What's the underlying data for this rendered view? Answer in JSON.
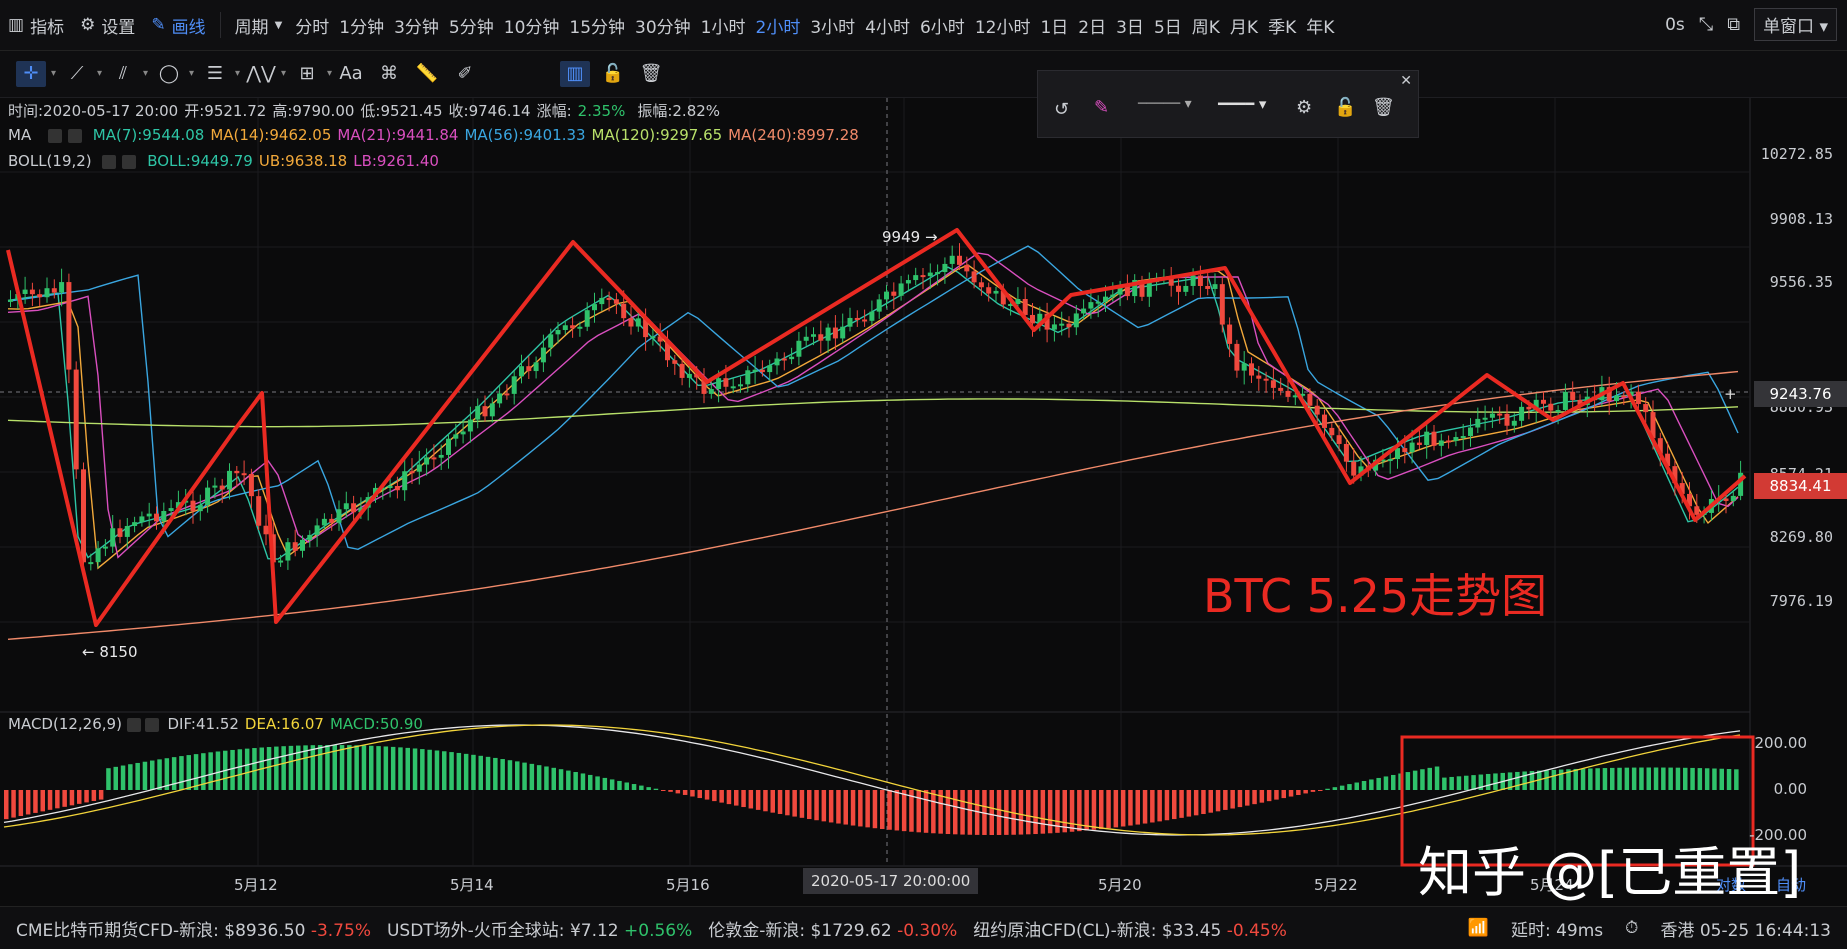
{
  "topbar": {
    "indicator": "指标",
    "settings": "设置",
    "draw": "画线",
    "period_label": "周期",
    "periods": [
      "分时",
      "1分钟",
      "3分钟",
      "5分钟",
      "10分钟",
      "15分钟",
      "30分钟",
      "1小时",
      "2小时",
      "3小时",
      "4小时",
      "6小时",
      "12小时",
      "1日",
      "2日",
      "3日",
      "5日",
      "周K",
      "月K",
      "季K",
      "年K"
    ],
    "active_period": "2小时",
    "right": {
      "counter": "0s",
      "window_mode": "单窗口"
    }
  },
  "info": {
    "line1": {
      "time": "时间:2020-05-17 20:00",
      "open": "开:9521.72",
      "high": "高:9790.00",
      "low": "低:9521.45",
      "close": "收:9746.14",
      "change_label": "涨幅:",
      "change": "2.35%",
      "amplitude": "振幅:2.82%"
    },
    "ma_label": "MA",
    "ma": [
      {
        "text": "MA(7):9544.08",
        "color": "#2ec5a6"
      },
      {
        "text": "MA(14):9462.05",
        "color": "#f2a93b"
      },
      {
        "text": "MA(21):9441.84",
        "color": "#d94fbf"
      },
      {
        "text": "MA(56):9401.33",
        "color": "#3aa6e0"
      },
      {
        "text": "MA(120):9297.65",
        "color": "#b8e06a"
      },
      {
        "text": "MA(240):8997.28",
        "color": "#f08a6a"
      }
    ],
    "boll_label": "BOLL(19,2)",
    "boll": [
      {
        "text": "BOLL:9449.79",
        "color": "#2ec5a6"
      },
      {
        "text": "UB:9638.18",
        "color": "#f2a93b"
      },
      {
        "text": "LB:9261.40",
        "color": "#d94fbf"
      }
    ]
  },
  "price_axis": [
    "10272.85",
    "9908.13",
    "9556.35",
    "9243.76",
    "8880.93",
    "8574.21",
    "8269.80",
    "7976.19"
  ],
  "crosshair_price": "9243.76",
  "last_price": "8834.41",
  "annotations": {
    "high_label": "9949 →",
    "low_label": "← 8150",
    "title": "BTC 5.25走势图"
  },
  "macd": {
    "label": "MACD(12,26,9)",
    "dif": "DIF:41.52",
    "dea": "DEA:16.07",
    "macd": "MACD:50.90",
    "ticks": [
      "200.00",
      "0.00",
      "-200.00"
    ]
  },
  "x_axis": [
    "5月12",
    "5月14",
    "5月16",
    "5月20",
    "5月22",
    "5月24"
  ],
  "crosshair_time": "2020-05-17 20:00:00",
  "x_extra": [
    "对数",
    "自动"
  ],
  "watermark": "知乎 @[已重置]",
  "tickers": [
    {
      "name": "CME比特币期货CFD-新浪:",
      "price": "$8936.50",
      "change": "-3.75%",
      "dir": "dn"
    },
    {
      "name": "USDT场外-火币全球站:",
      "price": "¥7.12",
      "change": "+0.56%",
      "dir": "up"
    },
    {
      "name": "伦敦金-新浪:",
      "price": "$1729.62",
      "change": "-0.30%",
      "dir": "dn"
    },
    {
      "name": "纽约原油CFD(CL)-新浪:",
      "price": "$33.45",
      "change": "-0.45%",
      "dir": "dn"
    }
  ],
  "status": {
    "latency": "延时: 49ms",
    "time": "香港 05-25 16:44:13"
  },
  "colors": {
    "up": "#2fc26b",
    "down": "#f0493e",
    "accent": "#4f8ef7",
    "annotation": "#ea2a22"
  }
}
